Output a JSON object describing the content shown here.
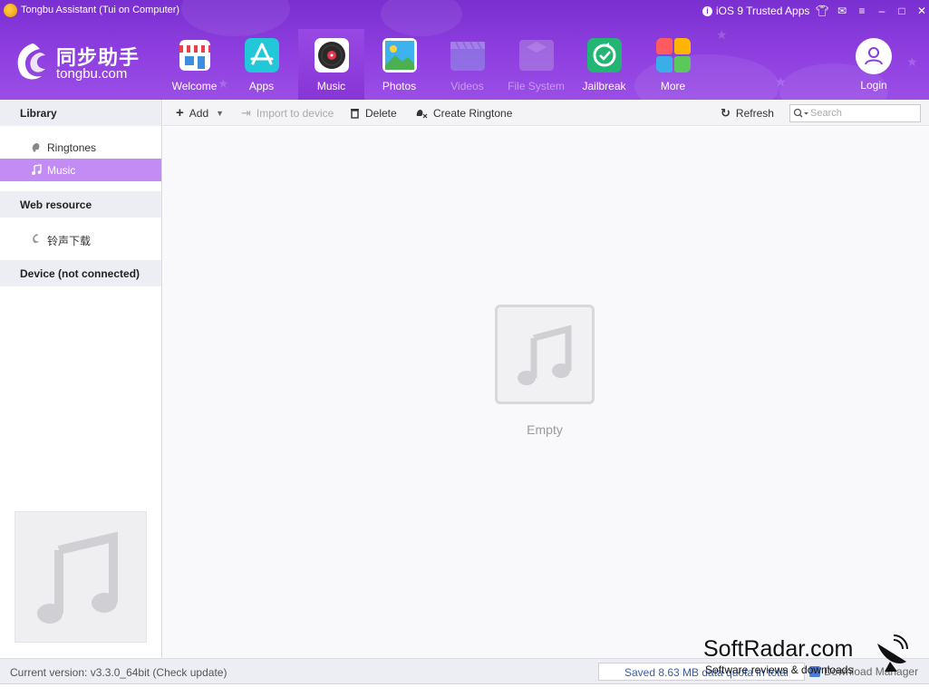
{
  "window": {
    "title": "Tongbu Assistant (Tui on Computer)",
    "trusted_apps_label": "iOS 9 Trusted Apps"
  },
  "logo": {
    "chinese": "同步助手",
    "english": "tongbu.com"
  },
  "nav": {
    "tabs": [
      {
        "label": "Welcome",
        "icon": "store-icon",
        "active": false,
        "disabled": false
      },
      {
        "label": "Apps",
        "icon": "app-store-icon",
        "active": false,
        "disabled": false
      },
      {
        "label": "Music",
        "icon": "vinyl-record-icon",
        "active": true,
        "disabled": false
      },
      {
        "label": "Photos",
        "icon": "photo-landscape-icon",
        "active": false,
        "disabled": false
      },
      {
        "label": "Videos",
        "icon": "clapperboard-icon",
        "active": false,
        "disabled": true
      },
      {
        "label": "File System",
        "icon": "folder-icon",
        "active": false,
        "disabled": true
      },
      {
        "label": "Jailbreak",
        "icon": "jailbreak-refresh-icon",
        "active": false,
        "disabled": false
      },
      {
        "label": "More",
        "icon": "grid-tiles-icon",
        "active": false,
        "disabled": false
      }
    ],
    "login_label": "Login"
  },
  "sidebar": {
    "library_heading": "Library",
    "library_items": [
      {
        "label": "Ringtones",
        "icon": "ringtone-bell-icon",
        "selected": false
      },
      {
        "label": "Music",
        "icon": "music-note-icon",
        "selected": true
      }
    ],
    "web_heading": "Web resource",
    "web_items": [
      {
        "label": "铃声下载",
        "icon": "tongbu-swirl-icon",
        "selected": false
      }
    ],
    "device_heading": "Device (not connected)"
  },
  "toolbar": {
    "add_label": "Add",
    "import_label": "Import to device",
    "delete_label": "Delete",
    "create_ringtone_label": "Create Ringtone",
    "refresh_label": "Refresh",
    "search_placeholder": "Search"
  },
  "main": {
    "empty_label": "Empty"
  },
  "status": {
    "version_text": "Current version: v3.3.0_64bit  (Check update)",
    "saved_text": "Saved 8.63 MB data quota in total",
    "download_manager_label": "Download Manager"
  },
  "watermark": {
    "brand": "SoftRadar.com",
    "tagline": "Software reviews & downloads"
  },
  "colors": {
    "header_purple": "#8a3dd8",
    "selected_item": "#c38cf5",
    "active_tab": "#8f40dc"
  }
}
